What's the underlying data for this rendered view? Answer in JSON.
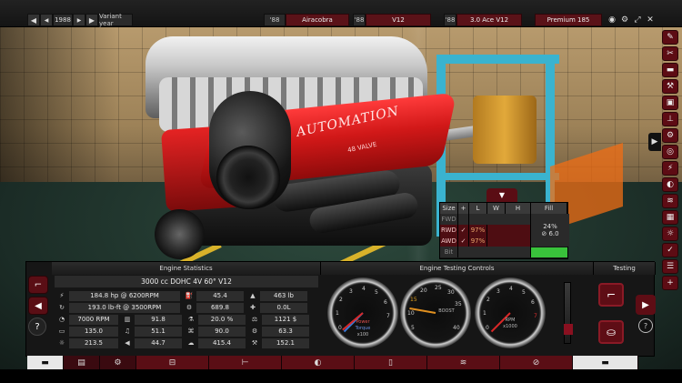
{
  "top_bar": {
    "year": "1988",
    "variant_label": "Variant year",
    "model": "Airacobra",
    "model_year": "'88",
    "engine": "V12",
    "engine_year": "'88",
    "family": "3.0 Ace V12",
    "family_year": "'88",
    "trim": "Premium 185",
    "icons": [
      "back-icon",
      "play-back-icon",
      "play-forward-icon",
      "forward-icon",
      "camera-icon",
      "gear-icon",
      "shrink-icon",
      "close-icon"
    ]
  },
  "side_menu_icons": [
    "wrench-icon",
    "scissors-icon",
    "car-icon",
    "tool-icon",
    "engine-icon",
    "piston-icon",
    "gear-icon",
    "wheel-icon",
    "bolt-icon",
    "turbo-icon",
    "exhaust-icon",
    "chart-icon",
    "sun-icon",
    "check-icon",
    "list-icon",
    "plus-icon"
  ],
  "size_panel": {
    "tab_icon": "chevron-down-icon",
    "headers": [
      "Size",
      "+",
      "L",
      "W",
      "H",
      "Fill"
    ],
    "rows": [
      {
        "label": "FWD",
        "check": "",
        "val": ""
      },
      {
        "label": "RWD",
        "check": "✓",
        "val": "97%"
      },
      {
        "label": "AWD",
        "check": "✓",
        "val": "97%"
      },
      {
        "label": "Bit",
        "check": "",
        "val": ""
      }
    ],
    "fill_pct": "24%",
    "fill_val": "6.0"
  },
  "engine_statistics": {
    "header": "Engine Statistics",
    "config": "3000 cc DOHC 4V 60° V12",
    "rows": [
      [
        "184.8 hp @ 6200RPM",
        "45.4",
        "463 lb"
      ],
      [
        "193.0 lb-ft @ 3500RPM",
        "689.8",
        "0.0L"
      ],
      [
        "7000 RPM",
        "91.8",
        "20.0 %",
        "1121 $"
      ],
      [
        "135.0",
        "51.1",
        "90.0",
        "63.3"
      ],
      [
        "213.5",
        "44.7",
        "415.4",
        "152.1"
      ]
    ]
  },
  "engine_testing": {
    "header": "Engine Testing Controls",
    "gauges": [
      {
        "label_top": "Power",
        "label_bottom": "Torque",
        "mult": "x100",
        "ticks": [
          "0",
          "1",
          "2",
          "3",
          "4",
          "5",
          "6",
          "7"
        ]
      },
      {
        "label_top": "BOOST",
        "label_bottom": "",
        "mult": "",
        "ticks": [
          "5",
          "10",
          "15",
          "20",
          "25",
          "30",
          "35",
          "40"
        ]
      },
      {
        "label_top": "RPM",
        "label_bottom": "x1000",
        "mult": "",
        "ticks": [
          "0",
          "1",
          "2",
          "3",
          "4",
          "5",
          "6",
          "7"
        ]
      }
    ]
  },
  "testing": {
    "header": "Testing"
  },
  "bottom_tabs": [
    {
      "name": "car-tab",
      "icon": "car-icon",
      "active": true
    },
    {
      "name": "chassis-tab",
      "icon": "chassis-icon",
      "active": false
    },
    {
      "name": "engine-tab",
      "icon": "engine-icon",
      "active": false
    },
    {
      "name": "block-tab",
      "icon": "block-icon",
      "active": false
    },
    {
      "name": "head-tab",
      "icon": "head-icon",
      "active": false
    },
    {
      "name": "turbo-tab",
      "icon": "turbo-icon",
      "active": false
    },
    {
      "name": "fuel-tab",
      "icon": "fuel-icon",
      "active": false
    },
    {
      "name": "exhaust-tab",
      "icon": "exhaust-icon",
      "active": false
    },
    {
      "name": "test-tab",
      "icon": "test-icon",
      "active": false
    },
    {
      "name": "finish-tab",
      "icon": "car-side-icon",
      "active": false
    }
  ]
}
